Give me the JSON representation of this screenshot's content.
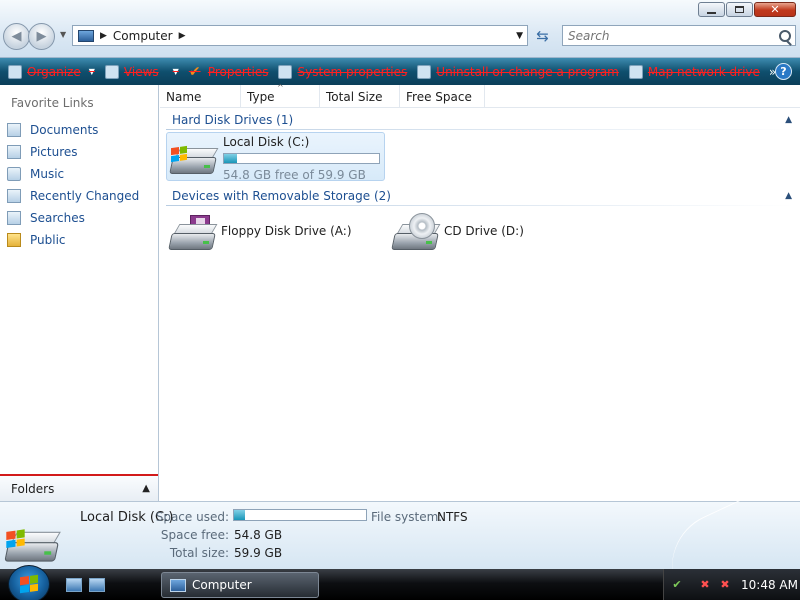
{
  "address": {
    "crumb": "Computer"
  },
  "search": {
    "placeholder": "Search"
  },
  "toolbar": {
    "organize": "Organize",
    "views": "Views",
    "properties": "Properties",
    "system_properties": "System properties",
    "uninstall": "Uninstall or change a program",
    "map_network_drive": "Map network drive",
    "more": "»",
    "help": "?"
  },
  "favorites": {
    "title": "Favorite Links",
    "items": [
      {
        "label": "Documents"
      },
      {
        "label": "Pictures"
      },
      {
        "label": "Music"
      },
      {
        "label": "Recently Changed"
      },
      {
        "label": "Searches"
      },
      {
        "label": "Public"
      }
    ],
    "folders_label": "Folders"
  },
  "columns": [
    "Name",
    "Type",
    "Total Size",
    "Free Space"
  ],
  "groups": {
    "hard_disks": "Hard Disk Drives (1)",
    "removable": "Devices with Removable Storage (2)"
  },
  "drives": {
    "local_disk": {
      "name": "Local Disk (C:)",
      "free_text": "54.8 GB free of 59.9 GB",
      "used_fraction": 0.085
    },
    "floppy": {
      "name": "Floppy Disk Drive (A:)"
    },
    "cd": {
      "name": "CD Drive (D:)"
    }
  },
  "details": {
    "name": "Local Disk (C:)",
    "space_used_label": "Space used:",
    "space_used_fraction": 0.085,
    "space_free_label": "Space free:",
    "space_free": "54.8 GB",
    "total_size_label": "Total size:",
    "total_size": "59.9 GB",
    "file_system_label": "File system:",
    "file_system": "NTFS"
  },
  "taskbar": {
    "task_label": "Computer",
    "clock": "10:48 AM"
  },
  "colors": {
    "accent_link": "#1d4f91",
    "command_bar": "#0f4f6e",
    "strike_text": "#ff2020",
    "progress": "#1996b8"
  }
}
